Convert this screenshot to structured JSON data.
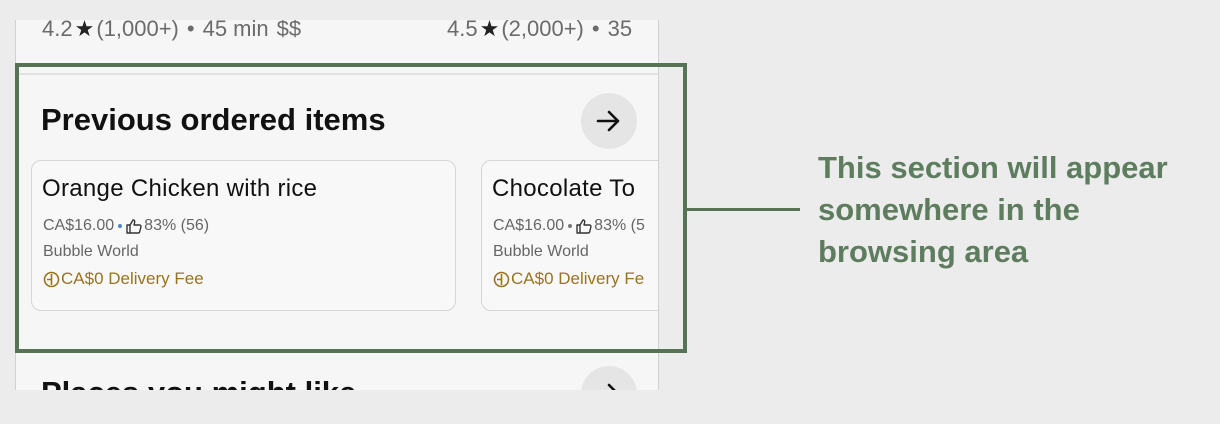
{
  "top_row": {
    "left_meta": {
      "rating": "4.2",
      "count": "(1,000+)",
      "separator": "•",
      "time": "45 min",
      "price": "$$"
    },
    "right_meta": {
      "rating": "4.5",
      "count": "(2,000+)",
      "separator": "•",
      "time": "35"
    }
  },
  "previous_section": {
    "title": "Previous ordered items",
    "arrow_label": "→",
    "cards": [
      {
        "title": "Orange Chicken with rice",
        "price": "CA$16.00",
        "rating": "83% (56)",
        "store": "Bubble World",
        "fee": "CA$0 Delivery Fee"
      },
      {
        "title": "Chocolate To",
        "price": "CA$16.00",
        "rating": "83% (5",
        "store": "Bubble World",
        "fee": "CA$0 Delivery Fe"
      }
    ]
  },
  "next_section": {
    "title": "Places you might like",
    "arrow_label": "→"
  },
  "annotation": {
    "text": "This section will appear somewhere in the browsing area"
  },
  "colors": {
    "highlight": "#567356",
    "annotation_text": "#5e7d5e",
    "fee_text": "#9a7320",
    "rating_dot": "#4a86c8"
  },
  "icons": [
    "star-icon",
    "arrow-right-icon",
    "thumbs-up-icon",
    "delivery-fee-icon"
  ]
}
